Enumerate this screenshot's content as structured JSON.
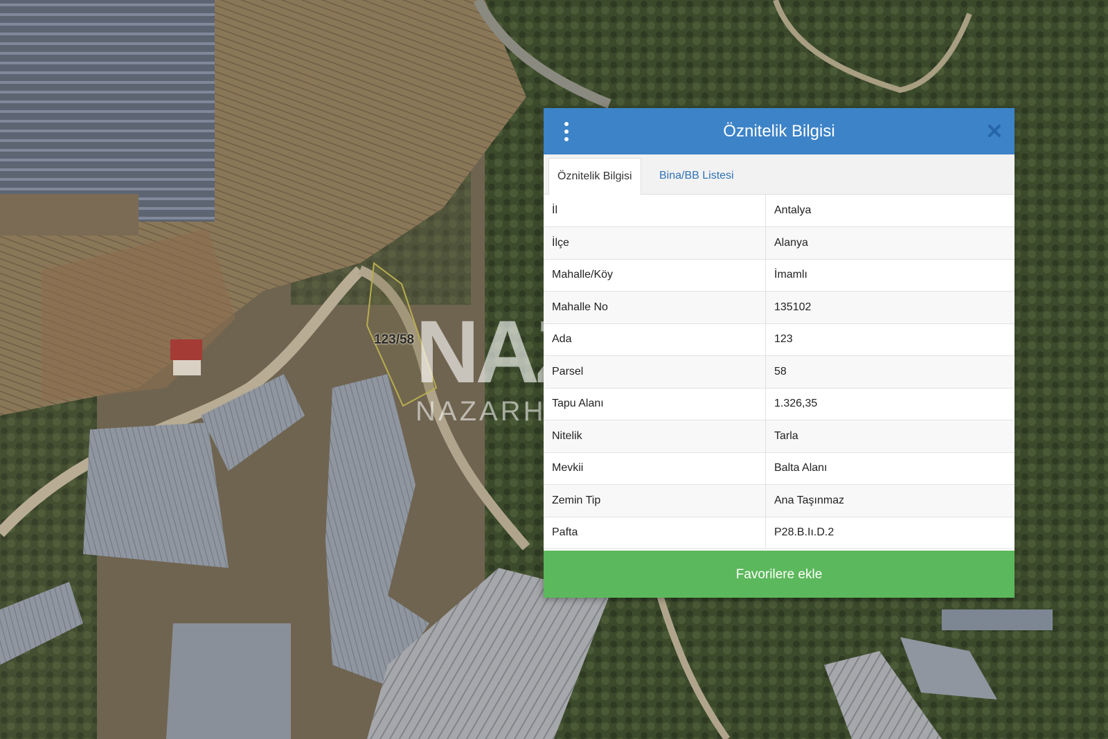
{
  "map": {
    "parcel_label": "123/58",
    "watermark_logo": "NAZ",
    "watermark_text": "NAZARHO"
  },
  "popup": {
    "title": "Öznitelik Bilgisi",
    "menu_icon": "kebab-menu-icon",
    "close_icon": "close-icon",
    "tabs": [
      {
        "label": "Öznitelik Bilgisi",
        "active": true
      },
      {
        "label": "Bina/BB Listesi",
        "active": false
      }
    ],
    "rows": [
      {
        "key": "İl",
        "value": "Antalya"
      },
      {
        "key": "İlçe",
        "value": "Alanya"
      },
      {
        "key": "Mahalle/Köy",
        "value": "İmamlı"
      },
      {
        "key": "Mahalle No",
        "value": "135102"
      },
      {
        "key": "Ada",
        "value": "123"
      },
      {
        "key": "Parsel",
        "value": "58"
      },
      {
        "key": "Tapu Alanı",
        "value": "1.326,35"
      },
      {
        "key": "Nitelik",
        "value": "Tarla"
      },
      {
        "key": "Mevkii",
        "value": "Balta Alanı"
      },
      {
        "key": "Zemin Tip",
        "value": "Ana Taşınmaz"
      },
      {
        "key": "Pafta",
        "value": "P28.B.Iı.D.2"
      }
    ],
    "favorite_button": "Favorilere ekle"
  },
  "colors": {
    "header": "#3d83c7",
    "tab_link": "#2f72b3",
    "button": "#5cb85c"
  }
}
